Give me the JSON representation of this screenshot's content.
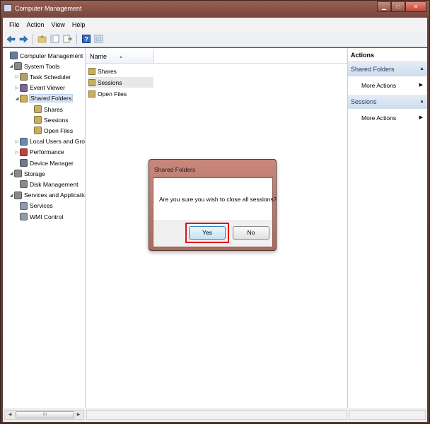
{
  "window": {
    "title": "Computer Management"
  },
  "window_controls": {
    "minimize": "▁",
    "maximize": "□",
    "close": "✕"
  },
  "menu": [
    "File",
    "Action",
    "View",
    "Help"
  ],
  "toolbar": {
    "icons": [
      "back-arrow-icon",
      "forward-arrow-icon",
      "up-folder-icon",
      "show-hide-tree-icon",
      "export-list-icon",
      "help-icon",
      "properties-icon"
    ]
  },
  "tree": [
    {
      "label": "Computer Management (Local",
      "level": 0,
      "arrow": "",
      "icon": "computer-icon",
      "color": "#6a7c9a"
    },
    {
      "label": "System Tools",
      "level": 1,
      "arrow": "◢",
      "icon": "tools-icon",
      "color": "#8a8a8a"
    },
    {
      "label": "Task Scheduler",
      "level": 2,
      "arrow": "▷",
      "icon": "clock-icon",
      "color": "#b0a070"
    },
    {
      "label": "Event Viewer",
      "level": 2,
      "arrow": "▷",
      "icon": "event-viewer-icon",
      "color": "#7a6a9a"
    },
    {
      "label": "Shared Folders",
      "level": 2,
      "arrow": "◢",
      "icon": "shared-folder-icon",
      "color": "#c8b060",
      "selected": true
    },
    {
      "label": "Shares",
      "level": 3,
      "arrow": "",
      "icon": "shares-icon",
      "color": "#c8b060"
    },
    {
      "label": "Sessions",
      "level": 3,
      "arrow": "",
      "icon": "sessions-icon",
      "color": "#c8b060"
    },
    {
      "label": "Open Files",
      "level": 3,
      "arrow": "",
      "icon": "open-files-icon",
      "color": "#c8b060"
    },
    {
      "label": "Local Users and Groups",
      "level": 2,
      "arrow": "▷",
      "icon": "users-icon",
      "color": "#6a8ab0"
    },
    {
      "label": "Performance",
      "level": 2,
      "arrow": "▷",
      "icon": "performance-icon",
      "color": "#c04040"
    },
    {
      "label": "Device Manager",
      "level": 2,
      "arrow": "",
      "icon": "device-manager-icon",
      "color": "#707a8a"
    },
    {
      "label": "Storage",
      "level": 1,
      "arrow": "◢",
      "icon": "storage-icon",
      "color": "#8a8a8a"
    },
    {
      "label": "Disk Management",
      "level": 2,
      "arrow": "",
      "icon": "disk-icon",
      "color": "#8a8a8a"
    },
    {
      "label": "Services and Applications",
      "level": 1,
      "arrow": "◢",
      "icon": "services-apps-icon",
      "color": "#8a8a8a"
    },
    {
      "label": "Services",
      "level": 2,
      "arrow": "",
      "icon": "services-icon",
      "color": "#909aa8"
    },
    {
      "label": "WMI Control",
      "level": 2,
      "arrow": "",
      "icon": "wmi-icon",
      "color": "#909aa8"
    }
  ],
  "list": {
    "column": "Name",
    "sort_indicator": "▲",
    "items": [
      {
        "label": "Shares",
        "selected": false
      },
      {
        "label": "Sessions",
        "selected": true
      },
      {
        "label": "Open Files",
        "selected": false
      }
    ]
  },
  "actions": {
    "title": "Actions",
    "sections": [
      {
        "label": "Shared Folders",
        "collapse": "▲",
        "item": "More Actions",
        "item_arrow": "▶"
      },
      {
        "label": "Sessions",
        "collapse": "▲",
        "item": "More Actions",
        "item_arrow": "▶"
      }
    ]
  },
  "scrollbar": {
    "left_arrow": "◀",
    "right_arrow": "▶",
    "grip": "III"
  },
  "dialog": {
    "title": "Shared Folders",
    "message": "Are you sure you wish to close all sessions?",
    "yes_label": "Yes",
    "no_label": "No",
    "highlight_color": "#e0101c"
  }
}
